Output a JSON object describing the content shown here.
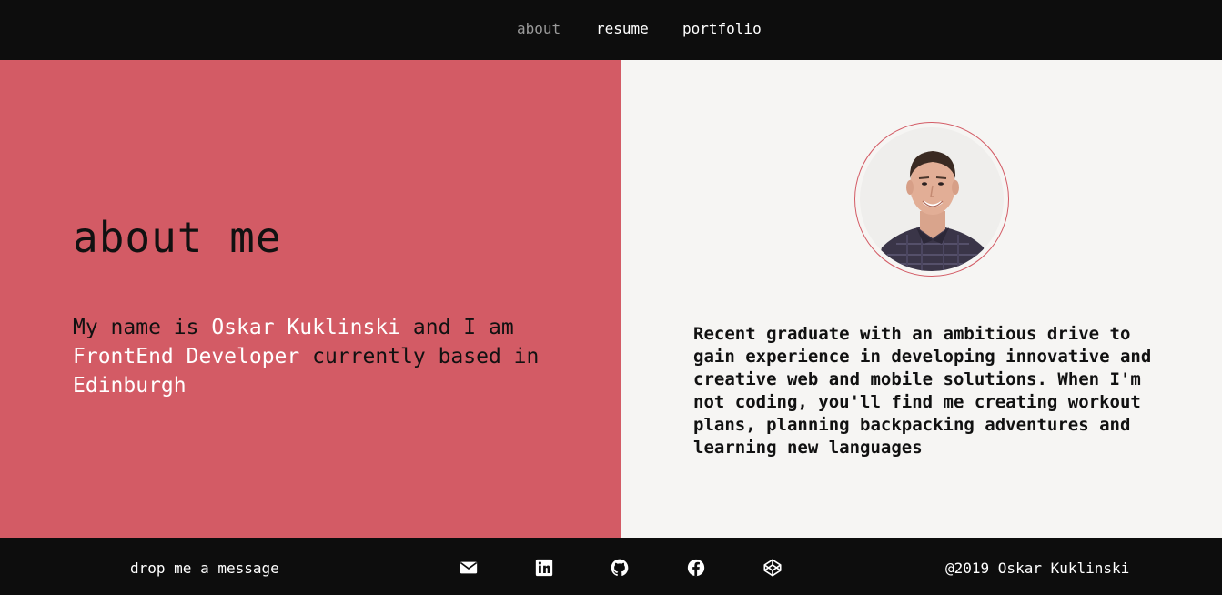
{
  "nav": {
    "items": [
      {
        "label": "about",
        "active": true
      },
      {
        "label": "resume",
        "active": false
      },
      {
        "label": "portfolio",
        "active": false
      }
    ]
  },
  "about": {
    "heading": "about me",
    "intro": {
      "prefix": "My name is ",
      "name": "Oskar Kuklinski",
      "middle": " and I am ",
      "role": "FrontEnd Developer",
      "suffix": " currently based in ",
      "city": "Edinburgh"
    },
    "bio": "Recent graduate with an ambitious drive to gain experience in developing innovative and creative web and mobile solutions. When I'm not coding, you'll find me creating workout plans, planning backpacking adventures and learning new languages"
  },
  "footer": {
    "message": "drop me a message",
    "social": [
      "mail-icon",
      "linkedin-icon",
      "github-icon",
      "facebook-icon",
      "codepen-icon"
    ],
    "copyright": "@2019 Oskar Kuklinski"
  },
  "colors": {
    "accent": "#d35b65",
    "dark": "#0d0d0d",
    "light": "#f6f5f3",
    "highlight": "#ffffff"
  }
}
